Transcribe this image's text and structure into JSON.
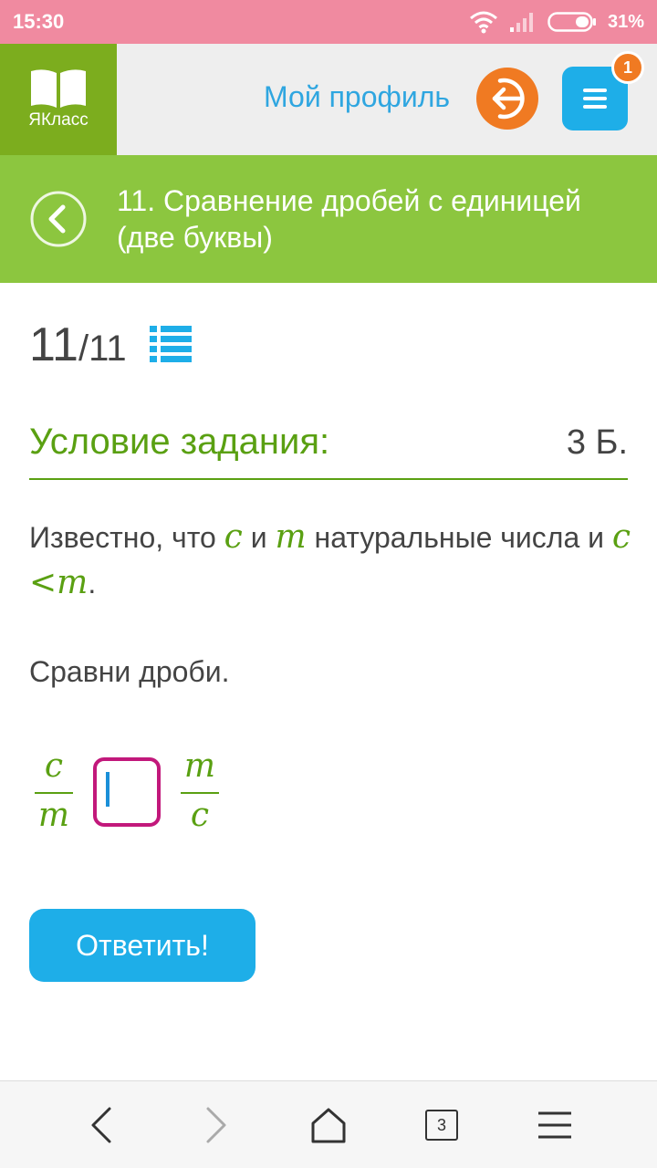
{
  "status_bar": {
    "time": "15:30",
    "battery": "31%"
  },
  "header": {
    "logo_text": "ЯКласс",
    "profile_link": "Мой профиль",
    "notification_count": "1"
  },
  "title_bar": {
    "title": "11. Сравнение дробей с единицей (две буквы)"
  },
  "counter": {
    "current": "11",
    "total": "/11"
  },
  "condition": {
    "title": "Условие задания:",
    "points": "3 Б."
  },
  "task": {
    "part1": "Известно, что ",
    "var1": "c",
    "part2": " и ",
    "var2": "m",
    "part3": " натуральные числа и ",
    "ineq": "c <m",
    "part4": ".",
    "compare_label": "Сравни дроби."
  },
  "fraction_left": {
    "numerator": "c",
    "denominator": "m"
  },
  "fraction_right": {
    "numerator": "m",
    "denominator": "c"
  },
  "answer": {
    "value": ""
  },
  "submit": {
    "label": "Ответить!"
  },
  "bottom_nav": {
    "tabs_count": "3"
  },
  "colors": {
    "brand_green": "#7cad1e",
    "title_green": "#8cc63f",
    "accent_blue": "#1eaee8",
    "accent_orange": "#f07a22",
    "input_border": "#c2187b"
  }
}
